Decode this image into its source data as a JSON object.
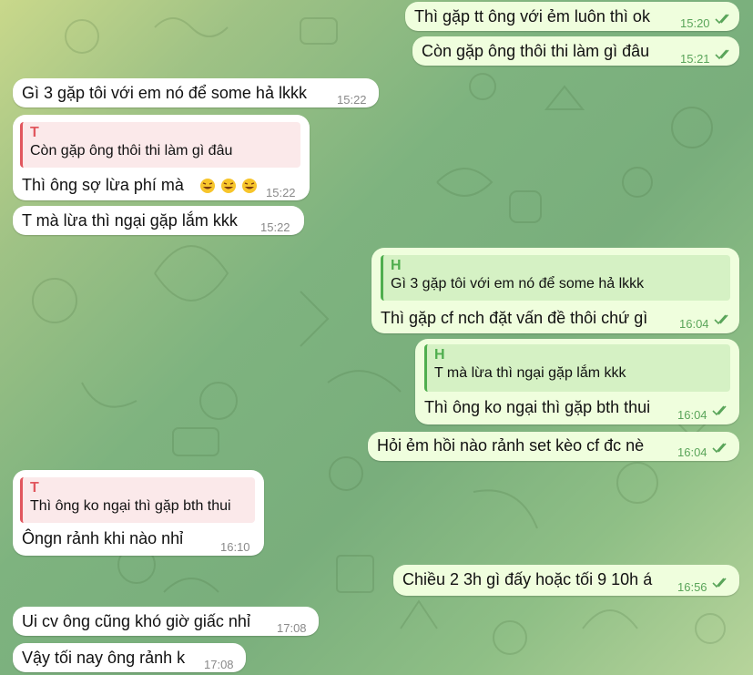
{
  "colors": {
    "incoming_bubble": "#ffffff",
    "outgoing_bubble": "#effedd",
    "reply_red": "#e1575e",
    "reply_green": "#4fae4e",
    "read_ticks": "#5aa55a"
  },
  "messages": [
    {
      "text": "Thì gặp tt ông với ẻm luôn thì ok",
      "time": "15:20"
    },
    {
      "text": "Còn gặp ông thôi thi làm gì đâu",
      "time": "15:21"
    },
    {
      "text": "Gì 3 gặp tôi với em nó để some hả lkkk",
      "time": "15:22"
    },
    {
      "reply_author": "T",
      "reply_text": "Còn gặp ông thôi thi làm gì đâu",
      "text": "Thì ông sợ lừa phí mà",
      "emoji": "rolling-on-floor-laughing ×3",
      "time": "15:22"
    },
    {
      "text": "T mà lừa thì ngại gặp lắm kkk",
      "time": "15:22"
    },
    {
      "reply_author": "H",
      "reply_text": "Gì 3 gặp tôi với em nó để some hả lkkk",
      "text": "Thì gặp cf nch đặt vấn đề thôi chứ gì",
      "time": "16:04"
    },
    {
      "reply_author": "H",
      "reply_text": "T mà lừa thì ngại gặp lắm kkk",
      "text": "Thì ông ko ngại thì gặp bth thui",
      "time": "16:04"
    },
    {
      "text": "Hỏi ẻm hồi nào rảnh set kèo cf đc nè",
      "time": "16:04"
    },
    {
      "reply_author": "T",
      "reply_text": "Thì ông ko ngại thì gặp bth thui",
      "text": "Ôngn rảnh khi nào nhỉ",
      "time": "16:10"
    },
    {
      "text": "Chiều 2 3h gì đấy hoặc tối 9 10h á",
      "time": "16:56"
    },
    {
      "text": "Ui cv ông cũng khó giờ giấc nhỉ",
      "time": "17:08"
    },
    {
      "text": "Vậy tối nay ông rảnh k",
      "time": "17:08"
    }
  ]
}
